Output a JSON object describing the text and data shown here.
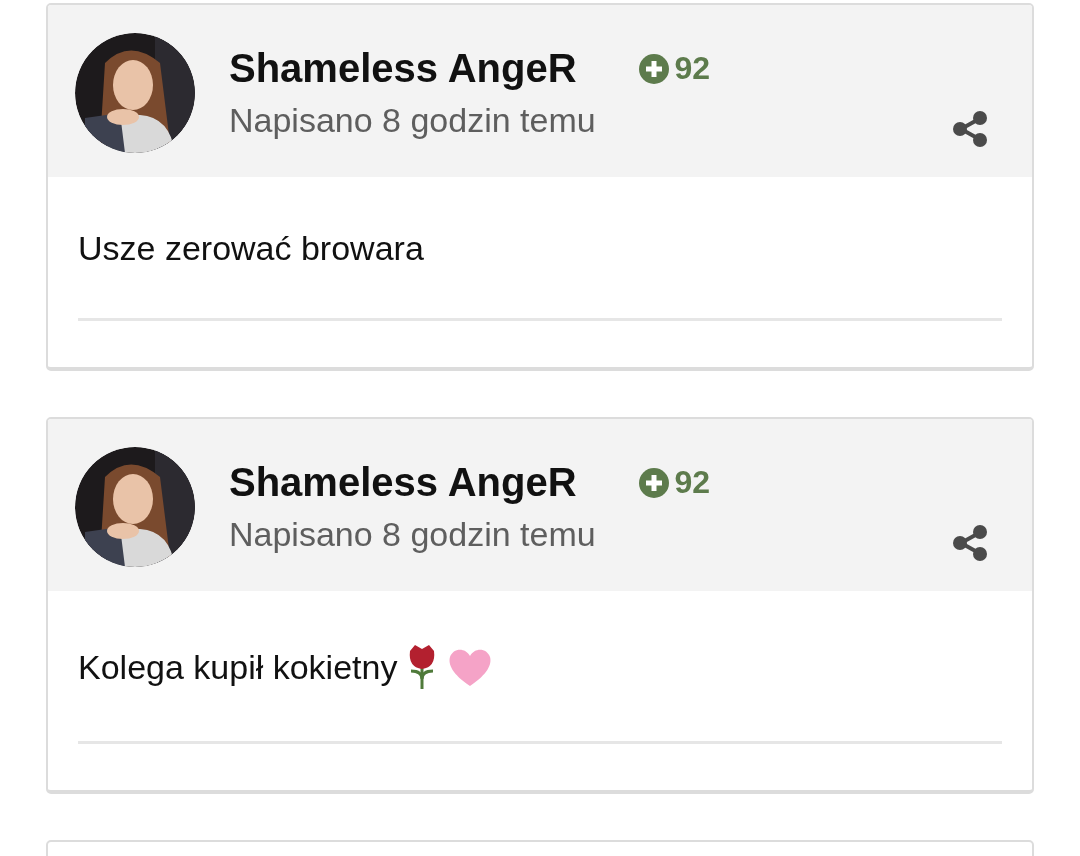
{
  "posts": [
    {
      "author": "Shameless AngeR",
      "reputation": "92",
      "time": "Napisano 8 godzin temu",
      "text": "Usze zerować browara"
    },
    {
      "author": "Shameless AngeR",
      "reputation": "92",
      "time": "Napisano 8 godzin temu",
      "text": "Kolega kupił kokietny",
      "icons": [
        {
          "kind": "rose"
        },
        {
          "kind": "heart"
        }
      ]
    }
  ]
}
